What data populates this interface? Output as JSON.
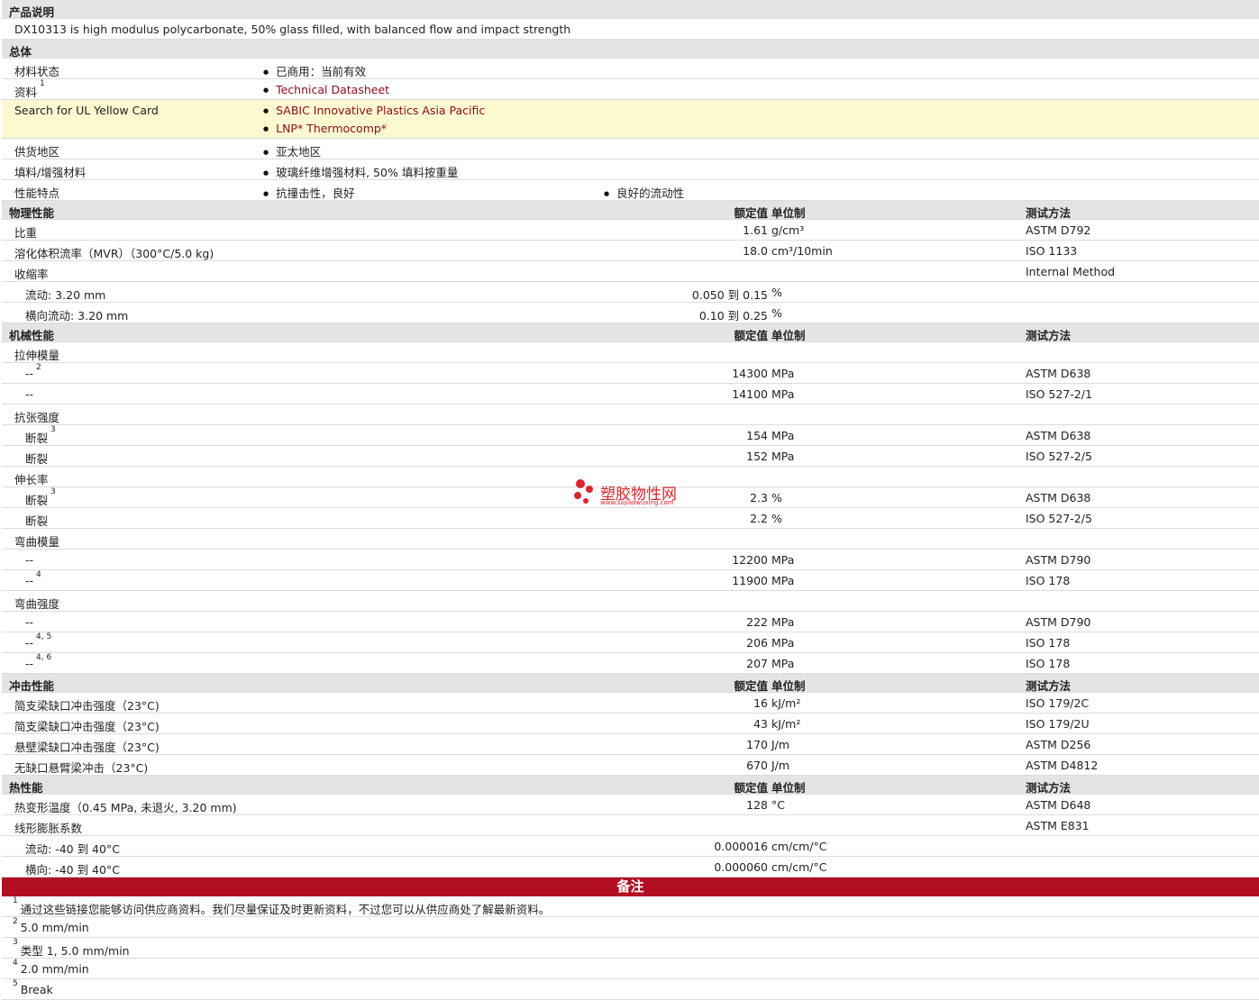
{
  "product": {
    "section_title": "产品说明",
    "description": "DX10313 is high modulus polycarbonate, 50% glass filled, with balanced flow and impact strength"
  },
  "general": {
    "section_title": "总体",
    "rows": {
      "status_label": "材料状态",
      "status_value": "已商用：当前有效",
      "docs_label": "资料",
      "docs_sup": "1",
      "docs_link": "Technical Datasheet",
      "ul_label": "Search for UL Yellow Card",
      "ul_link1": "SABIC Innovative Plastics Asia Pacific",
      "ul_link2": "LNP* Thermocomp*",
      "region_label": "供货地区",
      "region_value": "亚太地区",
      "filler_label": "填料/增强材料",
      "filler_value": "玻璃纤维增强材料, 50% 填料按重量",
      "feature_label": "性能特点",
      "feature_value1": "抗撞击性，良好",
      "feature_value2": "良好的流动性"
    }
  },
  "col_headers": {
    "value": "额定值",
    "unit": "单位制",
    "method": "测试方法"
  },
  "physical": {
    "section_title": "物理性能",
    "sg_label": "比重",
    "sg_value": "1.61",
    "sg_unit": "g/cm³",
    "sg_method": "ASTM D792",
    "mvr_label": "溶化体积流率（MVR）（300°C/5.0 kg)",
    "mvr_value": "18.0",
    "mvr_unit": "cm³/10min",
    "mvr_method": "ISO 1133",
    "shrink_label": "收缩率",
    "shrink_method": "Internal Method",
    "flow_label": "流动: 3.20 mm",
    "flow_value": "0.050 到  0.15",
    "flow_unit": "%",
    "xflow_label": "横向流动: 3.20 mm",
    "xflow_value": "0.10 到  0.25",
    "xflow_unit": "%"
  },
  "mechanical": {
    "section_title": "机械性能",
    "tm_label": "拉伸模量",
    "tm1_label": "--",
    "tm1_sup": "2",
    "tm1_value": "14300",
    "tm1_unit": "MPa",
    "tm1_method": "ASTM D638",
    "tm2_label": "--",
    "tm2_value": "14100",
    "tm2_unit": "MPa",
    "tm2_method": "ISO 527-2/1",
    "ts_label": "抗张强度",
    "ts1_label": "断裂",
    "ts1_sup": "3",
    "ts1_value": "154",
    "ts1_unit": "MPa",
    "ts1_method": "ASTM D638",
    "ts2_label": "断裂",
    "ts2_value": "152",
    "ts2_unit": "MPa",
    "ts2_method": "ISO 527-2/5",
    "el_label": "伸长率",
    "el1_label": "断裂",
    "el1_sup": "3",
    "el1_value": "2.3",
    "el1_unit": "%",
    "el1_method": "ASTM D638",
    "el2_label": "断裂",
    "el2_value": "2.2",
    "el2_unit": "%",
    "el2_method": "ISO 527-2/5",
    "fm_label": "弯曲模量",
    "fm1_label": "--",
    "fm1_value": "12200",
    "fm1_unit": "MPa",
    "fm1_method": "ASTM D790",
    "fm2_label": "--",
    "fm2_sup": "4",
    "fm2_value": "11900",
    "fm2_unit": "MPa",
    "fm2_method": "ISO 178",
    "fs_label": "弯曲强度",
    "fs1_label": "--",
    "fs1_value": "222",
    "fs1_unit": "MPa",
    "fs1_method": "ASTM D790",
    "fs2_label": "--",
    "fs2_sup": "4, 5",
    "fs2_value": "206",
    "fs2_unit": "MPa",
    "fs2_method": "ISO 178",
    "fs3_label": "--",
    "fs3_sup": "4, 6",
    "fs3_value": "207",
    "fs3_unit": "MPa",
    "fs3_method": "ISO 178"
  },
  "impact": {
    "section_title": "冲击性能",
    "c1_label": "简支梁缺口冲击强度（23°C)",
    "c1_value": "16",
    "c1_unit": "kJ/m²",
    "c1_method": "ISO 179/2C",
    "c2_label": "简支梁缺口冲击强度（23°C)",
    "c2_value": "43",
    "c2_unit": "kJ/m²",
    "c2_method": "ISO 179/2U",
    "i1_label": "悬壁梁缺口冲击强度（23°C)",
    "i1_value": "170",
    "i1_unit": "J/m",
    "i1_method": "ASTM D256",
    "i2_label": "无缺口悬臂梁冲击（23°C)",
    "i2_value": "670",
    "i2_unit": "J/m",
    "i2_method": "ASTM D4812"
  },
  "thermal": {
    "section_title": "热性能",
    "hdt_label": "热变形温度（0.45 MPa, 未退火, 3.20 mm)",
    "hdt_value": "128",
    "hdt_unit": "°C",
    "hdt_method": "ASTM D648",
    "clte_label": "线形膨胀系数",
    "clte_method": "ASTM E831",
    "clte1_label": "流动: -40 到  40°C",
    "clte1_value": "0.000016",
    "clte1_unit": "cm/cm/°C",
    "clte2_label": "横向: -40 到  40°C",
    "clte2_value": "0.000060",
    "clte2_unit": "cm/cm/°C"
  },
  "notes": {
    "title": "备注",
    "n1_sup": "1",
    "n1": "通过这些链接您能够访问供应商资料。我们尽量保证及时更新资料，不过您可以从供应商处了解最新资料。",
    "n2_sup": "2",
    "n2": "5.0 mm/min",
    "n3_sup": "3",
    "n3": "类型  1, 5.0 mm/min",
    "n4_sup": "4",
    "n4": "2.0 mm/min",
    "n5_sup": "5",
    "n5": "Break"
  },
  "watermark": {
    "name": "塑胶物性网",
    "url": "www.sujiaowuxing.com",
    "color": "#d9262b"
  }
}
